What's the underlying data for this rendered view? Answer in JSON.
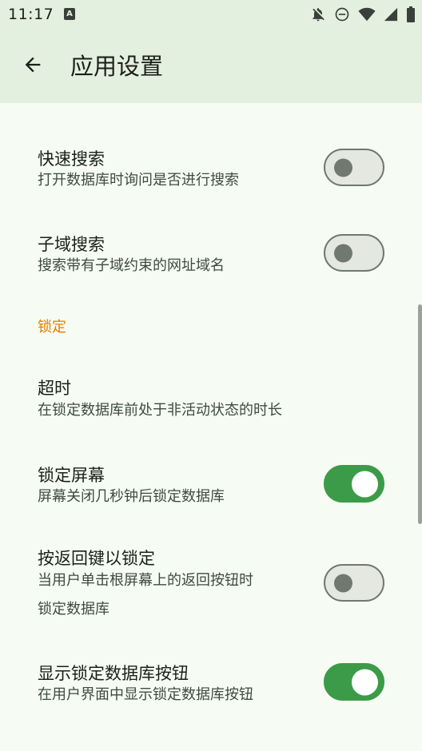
{
  "status_bar": {
    "time": "11:17",
    "app_badge": "A",
    "icons": [
      "notifications-off-icon",
      "do-not-disturb-icon",
      "wifi-icon",
      "cellular-signal-icon",
      "battery-icon"
    ]
  },
  "app_bar": {
    "back_icon": "arrow-back-icon",
    "title": "应用设置"
  },
  "preferences": {
    "quick_search": {
      "title": "快速搜索",
      "summary": "打开数据库时询问是否进行搜索",
      "enabled": false
    },
    "subdomain_search": {
      "title": "子域搜索",
      "summary": "搜索带有子域约束的网址域名",
      "enabled": false
    },
    "lock_section_header": "锁定",
    "timeout": {
      "title": "超时",
      "summary": "在锁定数据库前处于非活动状态的时长"
    },
    "lock_screen": {
      "title": "锁定屏幕",
      "summary": "屏幕关闭几秒钟后锁定数据库",
      "enabled": true
    },
    "back_to_lock": {
      "title": "按返回键以锁定",
      "summary_line1": "当用户单击根屏幕上的返回按钮时",
      "summary_line2": "锁定数据库",
      "enabled": false
    },
    "show_lock_button": {
      "title": "显示锁定数据库按钮",
      "summary": "在用户界面中显示锁定数据库按钮",
      "enabled": true
    }
  },
  "colors": {
    "accent": "#e47d00",
    "switch_on": "#3c9b48",
    "app_bar": "#e4f0df",
    "background": "#f6fcf3"
  }
}
